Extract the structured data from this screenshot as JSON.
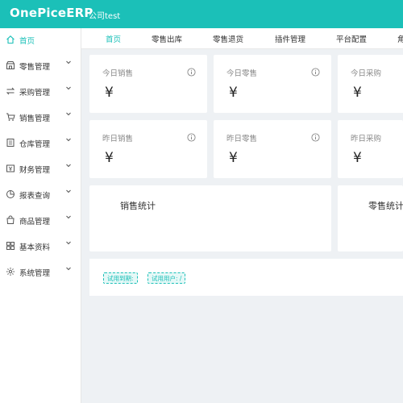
{
  "header": {
    "brand": "OnePiceERP",
    "company": "公司test",
    "color": "#1bc0b8"
  },
  "sidebar": {
    "items": [
      {
        "label": "首页",
        "icon": "home-icon",
        "active": true
      },
      {
        "label": "零售管理",
        "icon": "store-icon"
      },
      {
        "label": "采购管理",
        "icon": "swap-icon"
      },
      {
        "label": "销售管理",
        "icon": "cart-icon"
      },
      {
        "label": "仓库管理",
        "icon": "warehouse-icon"
      },
      {
        "label": "财务管理",
        "icon": "finance-icon"
      },
      {
        "label": "报表查询",
        "icon": "pie-chart-icon"
      },
      {
        "label": "商品管理",
        "icon": "bag-icon"
      },
      {
        "label": "基本资料",
        "icon": "grid-icon"
      },
      {
        "label": "系统管理",
        "icon": "settings-icon"
      }
    ]
  },
  "tabs": [
    {
      "label": "首页",
      "active": true
    },
    {
      "label": "零售出库"
    },
    {
      "label": "零售退货"
    },
    {
      "label": "插件管理"
    },
    {
      "label": "平台配置"
    },
    {
      "label": "角"
    }
  ],
  "cards": [
    {
      "title": "今日销售",
      "value": "¥"
    },
    {
      "title": "今日零售",
      "value": "¥"
    },
    {
      "title": "今日采购",
      "value": "¥"
    },
    {
      "title": "昨日销售",
      "value": "¥"
    },
    {
      "title": "昨日零售",
      "value": "¥"
    },
    {
      "title": "昨日采购",
      "value": "¥"
    }
  ],
  "stats": [
    {
      "title": "销售统计"
    },
    {
      "title": "零售统计"
    }
  ],
  "footer_tags": {
    "trial_expiry": "试用到期:",
    "trial_users": "试用用户: /"
  }
}
